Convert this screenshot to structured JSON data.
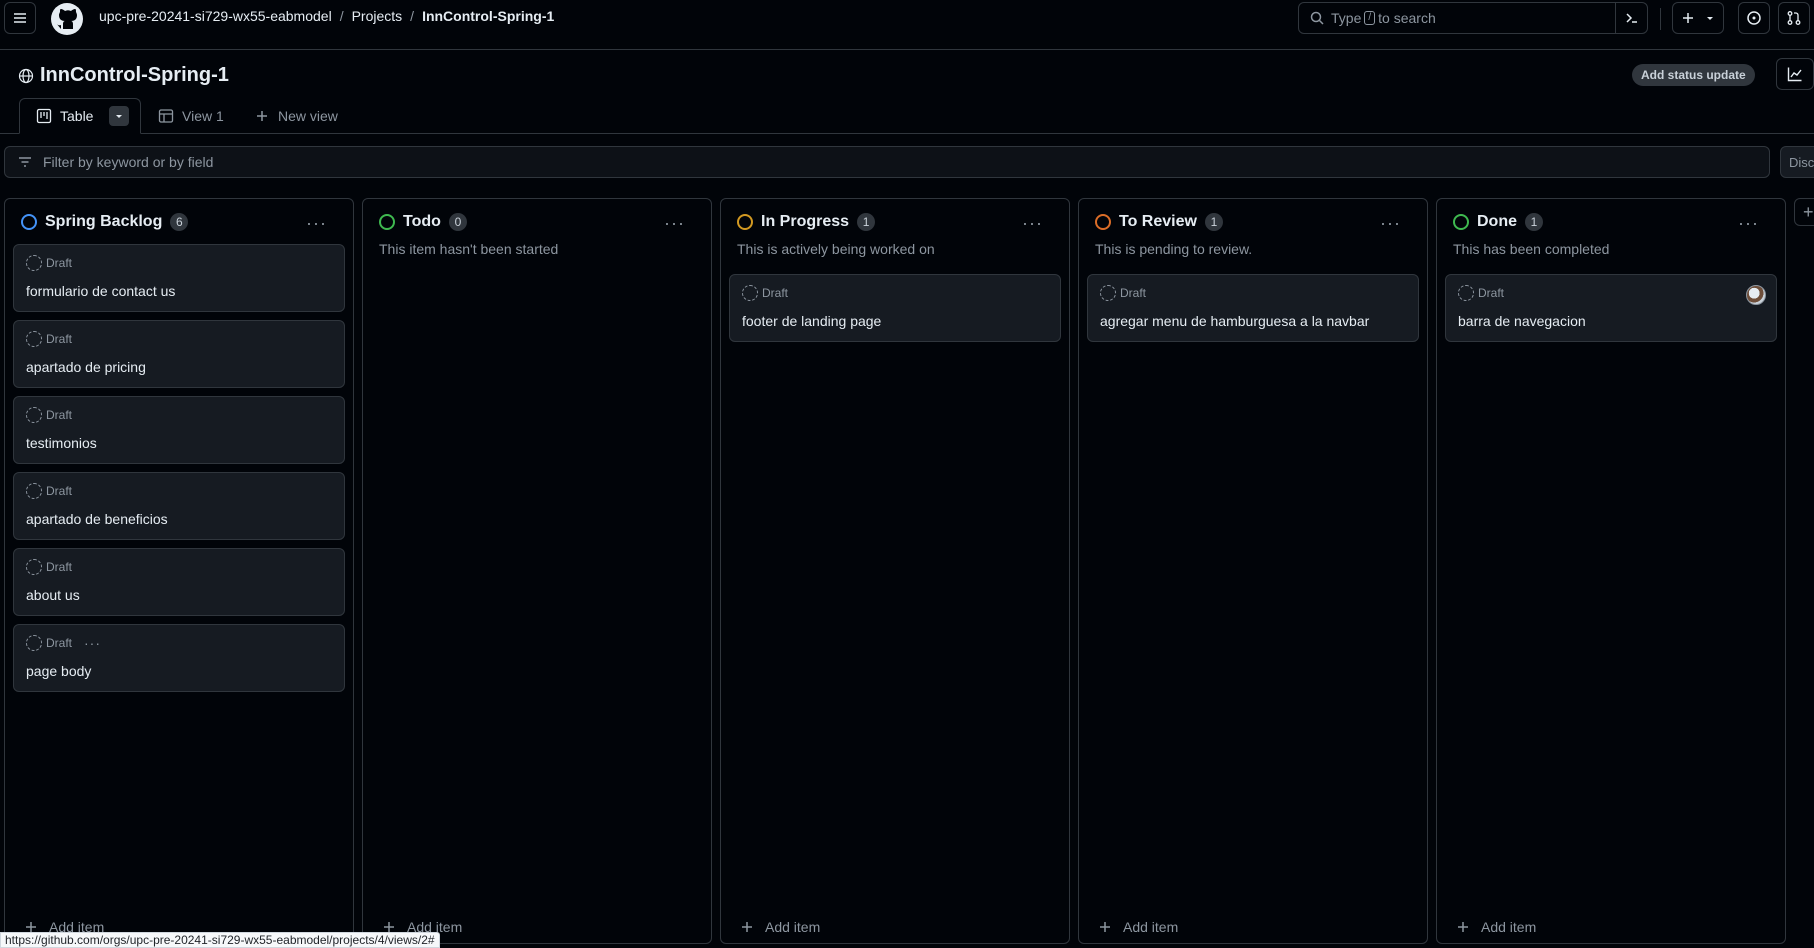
{
  "header": {
    "breadcrumb": {
      "org": "upc-pre-20241-si729-wx55-eabmodel",
      "sep1": "/",
      "projects": "Projects",
      "sep2": "/",
      "project": "InnControl-Spring-1"
    },
    "search": {
      "prefix": "Type",
      "key": "/",
      "suffix": "to search"
    }
  },
  "project": {
    "title": "InnControl-Spring-1",
    "status_button": "Add status update"
  },
  "tabs": [
    {
      "label": "Table",
      "active": true
    },
    {
      "label": "View 1"
    },
    {
      "label": "New view"
    }
  ],
  "filter": {
    "placeholder": "Filter by keyword or by field",
    "discard": "Disca"
  },
  "columns": [
    {
      "name": "Spring Backlog",
      "count": "6",
      "color": "#4493f8",
      "description": "",
      "cards": [
        {
          "status": "Draft",
          "title": "formulario de contact us"
        },
        {
          "status": "Draft",
          "title": "apartado de pricing"
        },
        {
          "status": "Draft",
          "title": "testimonios"
        },
        {
          "status": "Draft",
          "title": "apartado de beneficios"
        },
        {
          "status": "Draft",
          "title": "about us"
        },
        {
          "status": "Draft",
          "title": "page body",
          "more": "···"
        }
      ],
      "add_item": "Add item"
    },
    {
      "name": "Todo",
      "count": "0",
      "color": "#3fb950",
      "description": "This item hasn't been started",
      "cards": [],
      "add_item": "Add item"
    },
    {
      "name": "In Progress",
      "count": "1",
      "color": "#d29922",
      "description": "This is actively being worked on",
      "cards": [
        {
          "status": "Draft",
          "title": "footer de landing page"
        }
      ],
      "add_item": "Add item"
    },
    {
      "name": "To Review",
      "count": "1",
      "color": "#db6d28",
      "description": "This is pending to review.",
      "cards": [
        {
          "status": "Draft",
          "title": "agregar menu de hamburguesa a la navbar"
        }
      ],
      "add_item": "Add item"
    },
    {
      "name": "Done",
      "count": "1",
      "color": "#3fb950",
      "description": "This has been completed",
      "cards": [
        {
          "status": "Draft",
          "title": "barra de navegacion",
          "avatar": true
        }
      ],
      "add_item": "Add item"
    }
  ],
  "column_menu": "···",
  "add_column": "+",
  "status_url": "https://github.com/orgs/upc-pre-20241-si729-wx55-eabmodel/projects/4/views/2#"
}
